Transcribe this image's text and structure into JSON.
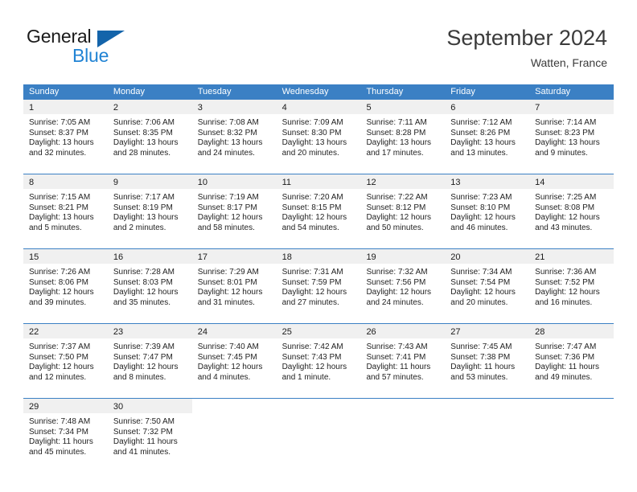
{
  "brand": {
    "name_part1": "General",
    "name_part2": "Blue",
    "flag_icon": "triangle-flag-icon",
    "accent_color": "#1464aa",
    "blue_text_color": "#2083d4"
  },
  "header": {
    "title": "September 2024",
    "location": "Watten, France"
  },
  "calendar": {
    "header_bg": "#3b80c4",
    "daynum_bg": "#f0f0f0",
    "weekdays": [
      "Sunday",
      "Monday",
      "Tuesday",
      "Wednesday",
      "Thursday",
      "Friday",
      "Saturday"
    ],
    "weeks": [
      [
        {
          "day": "1",
          "sunrise": "Sunrise: 7:05 AM",
          "sunset": "Sunset: 8:37 PM",
          "daylight1": "Daylight: 13 hours",
          "daylight2": "and 32 minutes."
        },
        {
          "day": "2",
          "sunrise": "Sunrise: 7:06 AM",
          "sunset": "Sunset: 8:35 PM",
          "daylight1": "Daylight: 13 hours",
          "daylight2": "and 28 minutes."
        },
        {
          "day": "3",
          "sunrise": "Sunrise: 7:08 AM",
          "sunset": "Sunset: 8:32 PM",
          "daylight1": "Daylight: 13 hours",
          "daylight2": "and 24 minutes."
        },
        {
          "day": "4",
          "sunrise": "Sunrise: 7:09 AM",
          "sunset": "Sunset: 8:30 PM",
          "daylight1": "Daylight: 13 hours",
          "daylight2": "and 20 minutes."
        },
        {
          "day": "5",
          "sunrise": "Sunrise: 7:11 AM",
          "sunset": "Sunset: 8:28 PM",
          "daylight1": "Daylight: 13 hours",
          "daylight2": "and 17 minutes."
        },
        {
          "day": "6",
          "sunrise": "Sunrise: 7:12 AM",
          "sunset": "Sunset: 8:26 PM",
          "daylight1": "Daylight: 13 hours",
          "daylight2": "and 13 minutes."
        },
        {
          "day": "7",
          "sunrise": "Sunrise: 7:14 AM",
          "sunset": "Sunset: 8:23 PM",
          "daylight1": "Daylight: 13 hours",
          "daylight2": "and 9 minutes."
        }
      ],
      [
        {
          "day": "8",
          "sunrise": "Sunrise: 7:15 AM",
          "sunset": "Sunset: 8:21 PM",
          "daylight1": "Daylight: 13 hours",
          "daylight2": "and 5 minutes."
        },
        {
          "day": "9",
          "sunrise": "Sunrise: 7:17 AM",
          "sunset": "Sunset: 8:19 PM",
          "daylight1": "Daylight: 13 hours",
          "daylight2": "and 2 minutes."
        },
        {
          "day": "10",
          "sunrise": "Sunrise: 7:19 AM",
          "sunset": "Sunset: 8:17 PM",
          "daylight1": "Daylight: 12 hours",
          "daylight2": "and 58 minutes."
        },
        {
          "day": "11",
          "sunrise": "Sunrise: 7:20 AM",
          "sunset": "Sunset: 8:15 PM",
          "daylight1": "Daylight: 12 hours",
          "daylight2": "and 54 minutes."
        },
        {
          "day": "12",
          "sunrise": "Sunrise: 7:22 AM",
          "sunset": "Sunset: 8:12 PM",
          "daylight1": "Daylight: 12 hours",
          "daylight2": "and 50 minutes."
        },
        {
          "day": "13",
          "sunrise": "Sunrise: 7:23 AM",
          "sunset": "Sunset: 8:10 PM",
          "daylight1": "Daylight: 12 hours",
          "daylight2": "and 46 minutes."
        },
        {
          "day": "14",
          "sunrise": "Sunrise: 7:25 AM",
          "sunset": "Sunset: 8:08 PM",
          "daylight1": "Daylight: 12 hours",
          "daylight2": "and 43 minutes."
        }
      ],
      [
        {
          "day": "15",
          "sunrise": "Sunrise: 7:26 AM",
          "sunset": "Sunset: 8:06 PM",
          "daylight1": "Daylight: 12 hours",
          "daylight2": "and 39 minutes."
        },
        {
          "day": "16",
          "sunrise": "Sunrise: 7:28 AM",
          "sunset": "Sunset: 8:03 PM",
          "daylight1": "Daylight: 12 hours",
          "daylight2": "and 35 minutes."
        },
        {
          "day": "17",
          "sunrise": "Sunrise: 7:29 AM",
          "sunset": "Sunset: 8:01 PM",
          "daylight1": "Daylight: 12 hours",
          "daylight2": "and 31 minutes."
        },
        {
          "day": "18",
          "sunrise": "Sunrise: 7:31 AM",
          "sunset": "Sunset: 7:59 PM",
          "daylight1": "Daylight: 12 hours",
          "daylight2": "and 27 minutes."
        },
        {
          "day": "19",
          "sunrise": "Sunrise: 7:32 AM",
          "sunset": "Sunset: 7:56 PM",
          "daylight1": "Daylight: 12 hours",
          "daylight2": "and 24 minutes."
        },
        {
          "day": "20",
          "sunrise": "Sunrise: 7:34 AM",
          "sunset": "Sunset: 7:54 PM",
          "daylight1": "Daylight: 12 hours",
          "daylight2": "and 20 minutes."
        },
        {
          "day": "21",
          "sunrise": "Sunrise: 7:36 AM",
          "sunset": "Sunset: 7:52 PM",
          "daylight1": "Daylight: 12 hours",
          "daylight2": "and 16 minutes."
        }
      ],
      [
        {
          "day": "22",
          "sunrise": "Sunrise: 7:37 AM",
          "sunset": "Sunset: 7:50 PM",
          "daylight1": "Daylight: 12 hours",
          "daylight2": "and 12 minutes."
        },
        {
          "day": "23",
          "sunrise": "Sunrise: 7:39 AM",
          "sunset": "Sunset: 7:47 PM",
          "daylight1": "Daylight: 12 hours",
          "daylight2": "and 8 minutes."
        },
        {
          "day": "24",
          "sunrise": "Sunrise: 7:40 AM",
          "sunset": "Sunset: 7:45 PM",
          "daylight1": "Daylight: 12 hours",
          "daylight2": "and 4 minutes."
        },
        {
          "day": "25",
          "sunrise": "Sunrise: 7:42 AM",
          "sunset": "Sunset: 7:43 PM",
          "daylight1": "Daylight: 12 hours",
          "daylight2": "and 1 minute."
        },
        {
          "day": "26",
          "sunrise": "Sunrise: 7:43 AM",
          "sunset": "Sunset: 7:41 PM",
          "daylight1": "Daylight: 11 hours",
          "daylight2": "and 57 minutes."
        },
        {
          "day": "27",
          "sunrise": "Sunrise: 7:45 AM",
          "sunset": "Sunset: 7:38 PM",
          "daylight1": "Daylight: 11 hours",
          "daylight2": "and 53 minutes."
        },
        {
          "day": "28",
          "sunrise": "Sunrise: 7:47 AM",
          "sunset": "Sunset: 7:36 PM",
          "daylight1": "Daylight: 11 hours",
          "daylight2": "and 49 minutes."
        }
      ],
      [
        {
          "day": "29",
          "sunrise": "Sunrise: 7:48 AM",
          "sunset": "Sunset: 7:34 PM",
          "daylight1": "Daylight: 11 hours",
          "daylight2": "and 45 minutes."
        },
        {
          "day": "30",
          "sunrise": "Sunrise: 7:50 AM",
          "sunset": "Sunset: 7:32 PM",
          "daylight1": "Daylight: 11 hours",
          "daylight2": "and 41 minutes."
        },
        {
          "day": "",
          "sunrise": "",
          "sunset": "",
          "daylight1": "",
          "daylight2": ""
        },
        {
          "day": "",
          "sunrise": "",
          "sunset": "",
          "daylight1": "",
          "daylight2": ""
        },
        {
          "day": "",
          "sunrise": "",
          "sunset": "",
          "daylight1": "",
          "daylight2": ""
        },
        {
          "day": "",
          "sunrise": "",
          "sunset": "",
          "daylight1": "",
          "daylight2": ""
        },
        {
          "day": "",
          "sunrise": "",
          "sunset": "",
          "daylight1": "",
          "daylight2": ""
        }
      ]
    ]
  }
}
